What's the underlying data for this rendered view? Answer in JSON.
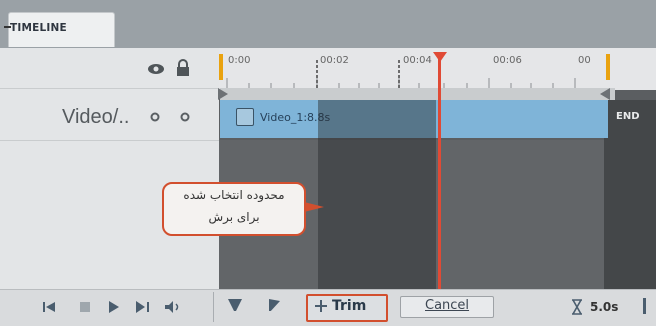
{
  "tab": {
    "label": "TIMELINE"
  },
  "track": {
    "label": "Video/..",
    "clip_label": "Video_1:8.8s",
    "end_label": "END"
  },
  "ruler": {
    "ticks": [
      "0:00",
      "00:02",
      "00:04",
      "00:06",
      "00"
    ]
  },
  "toolbar": {
    "trim_label": "Trim",
    "cancel_label": "Cancel",
    "duration": "5.0s"
  },
  "callout": {
    "line1": "محدوده انتخاب شده",
    "line2": "برای برش"
  },
  "colors": {
    "accent": "#d24f2e",
    "playhead": "#e04a35",
    "clip": "#7fb4d8"
  },
  "icons": [
    "eye-icon",
    "lock-icon",
    "go-start-icon",
    "stop-icon",
    "play-icon",
    "go-end-icon",
    "volume-icon",
    "mark-in-icon",
    "mark-out-icon",
    "trim-icon",
    "hourglass-icon"
  ]
}
